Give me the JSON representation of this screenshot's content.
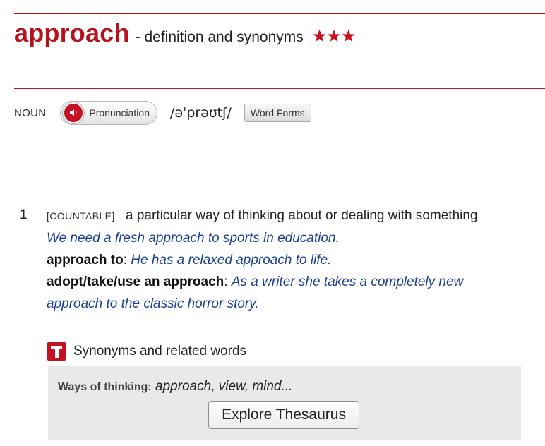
{
  "entry": {
    "headword": "approach",
    "subtitle": "- definition and synonyms",
    "stars": "★★★",
    "part_of_speech": "NOUN",
    "pronunciation_label": "Pronunciation",
    "ipa": "/əˈprəʊtʃ/",
    "word_forms_label": "Word Forms"
  },
  "sense": {
    "number": "1",
    "grammar": "[COUNTABLE]",
    "definition": "a particular way of thinking about or dealing with something",
    "example": "We need a fresh approach to sports in education.",
    "patterns": [
      {
        "phrase": "approach to",
        "sep": ":",
        "example": "He has a relaxed approach to life."
      },
      {
        "phrase": "adopt/take/use an approach",
        "sep": ":",
        "example": "As a writer she takes a completely new approach to the classic horror story."
      }
    ]
  },
  "synonyms": {
    "label": "Synonyms and related words",
    "category": "Ways of thinking:",
    "words": "approach, view, mind...",
    "button_label": "Explore Thesaurus"
  },
  "colors": {
    "brand": "#b5121b",
    "example_text": "#1b3f95",
    "thesaurus_bg": "#e9e9e9"
  },
  "icons": {
    "pronunciation": "speaker-icon",
    "thesaurus": "thesaurus-t-icon"
  }
}
